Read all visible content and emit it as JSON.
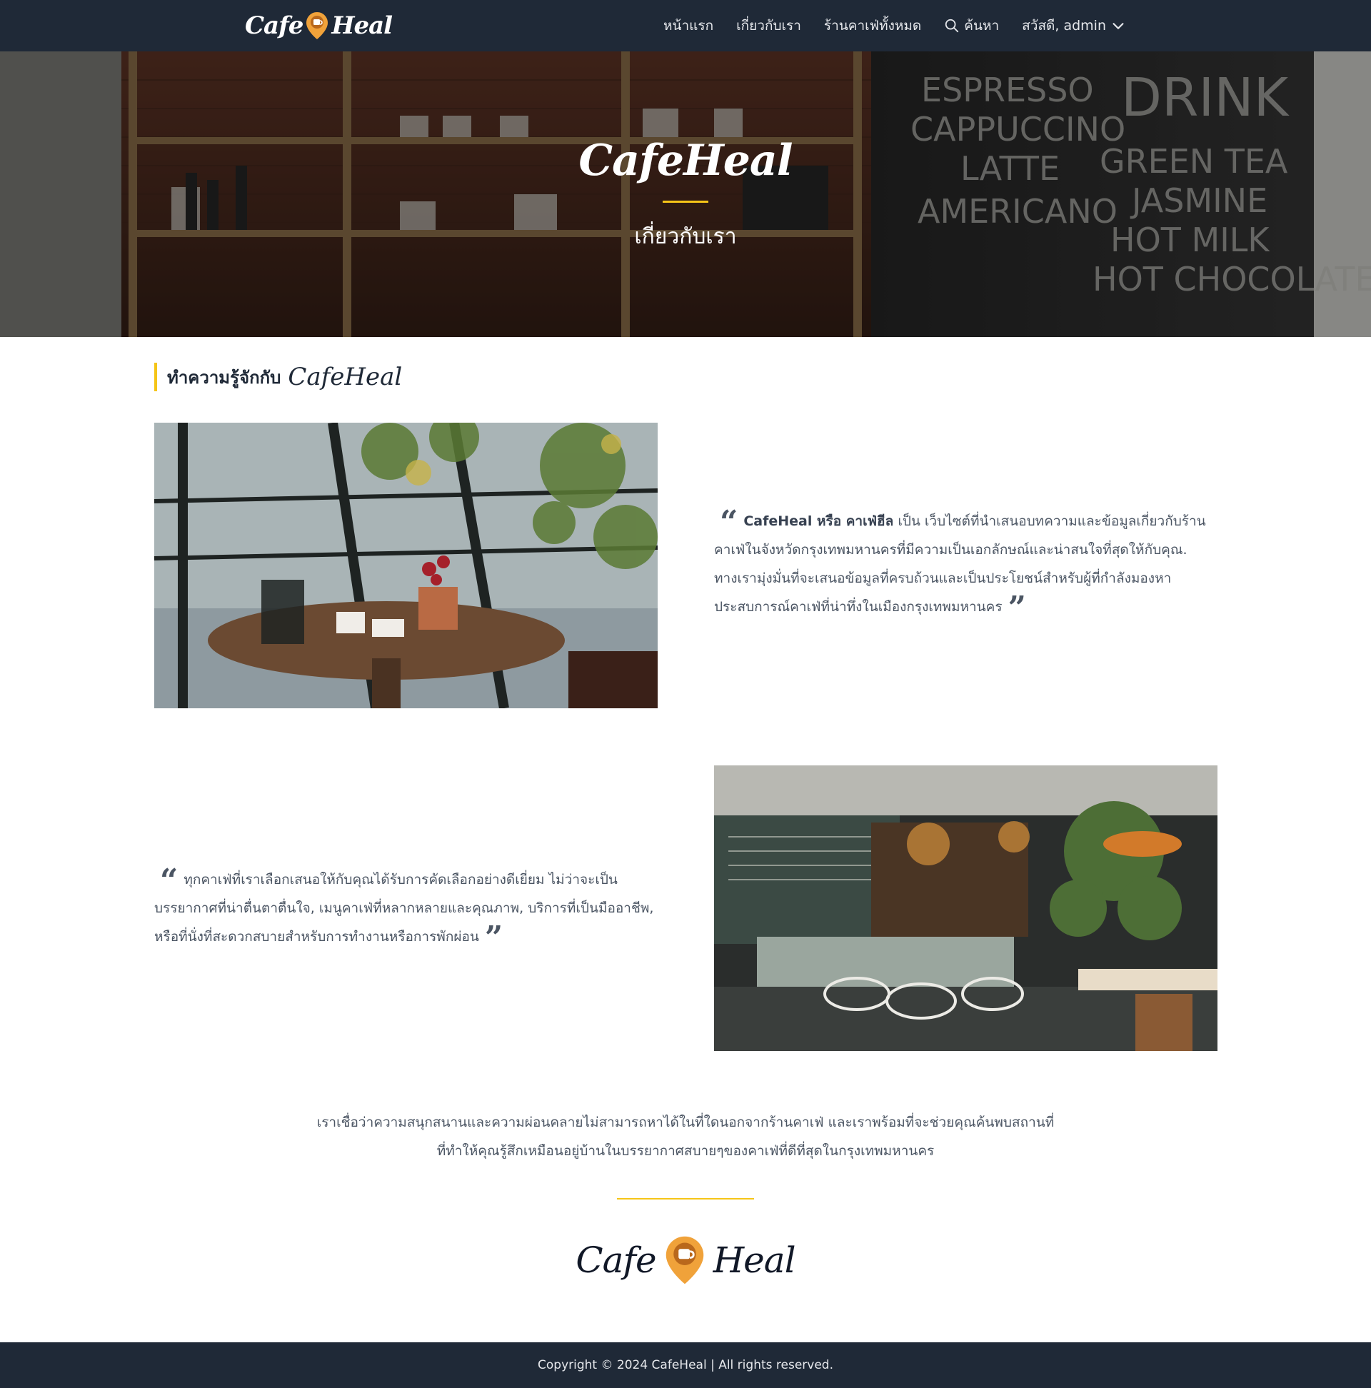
{
  "nav": {
    "brand_left": "Cafe",
    "brand_right": "Heal",
    "links": [
      "หน้าแรก",
      "เกี่ยวกับเรา",
      "ร้านคาเฟ่ทั้งหมด"
    ],
    "search_label": "ค้นหา",
    "user_label": "สวัสดี, admin"
  },
  "hero": {
    "title": "CafeHeal",
    "subtitle": "เกี่ยวกับเรา"
  },
  "section": {
    "heading": "ทำความรู้จักกับ",
    "heading_brand": "CafeHeal"
  },
  "quote1": {
    "bold": "CafeHeal หรือ คาเฟ่ฮีล",
    "text": "เป็น เว็บไซต์ที่นำเสนอบทความและข้อมูลเกี่ยวกับร้านคาเฟ่ในจังหวัดกรุงเทพมหานครที่มีความเป็นเอกลักษณ์และน่าสนใจที่สุดให้กับคุณ. ทางเรามุ่งมั่นที่จะเสนอข้อมูลที่ครบถ้วนและเป็นประโยชน์สำหรับผู้ที่กำลังมองหาประสบการณ์คาเฟ่ที่น่าทึ่งในเมืองกรุงเทพมหานคร"
  },
  "quote2": {
    "text": "ทุกคาเฟ่ที่เราเลือกเสนอให้กับคุณได้รับการคัดเลือกอย่างดีเยี่ยม ไม่ว่าจะเป็นบรรยากาศที่น่าตื่นตาตื่นใจ, เมนูคาเฟ่ที่หลากหลายและคุณภาพ, บริการที่เป็นมืออาชีพ, หรือที่นั่งที่สะดวกสบายสำหรับการทำงานหรือการพักผ่อน"
  },
  "closing": {
    "text": "เราเชื่อว่าความสนุกสนานและความผ่อนคลายไม่สามารถหาได้ในที่ใดนอกจากร้านคาเฟ่ และเราพร้อมที่จะช่วยคุณค้นพบสถานที่ที่ทำให้คุณรู้สึกเหมือนอยู่บ้านในบรรยากาศสบายๆของคาเฟ่ที่ดีที่สุดในกรุงเทพมหานคร"
  },
  "footer_brand": {
    "left": "Cafe",
    "right": "Heal"
  },
  "footer": {
    "copyright": "Copyright © 2024 CafeHeal | All rights reserved."
  },
  "colors": {
    "navbar_bg": "#1f2937",
    "accent": "#f5c518",
    "pin_orange": "#f0a23a",
    "text": "#4b5563"
  },
  "icons": [
    "map-pin-cup-icon",
    "search-icon",
    "chevron-down-icon",
    "quote-open-icon",
    "quote-close-icon"
  ]
}
